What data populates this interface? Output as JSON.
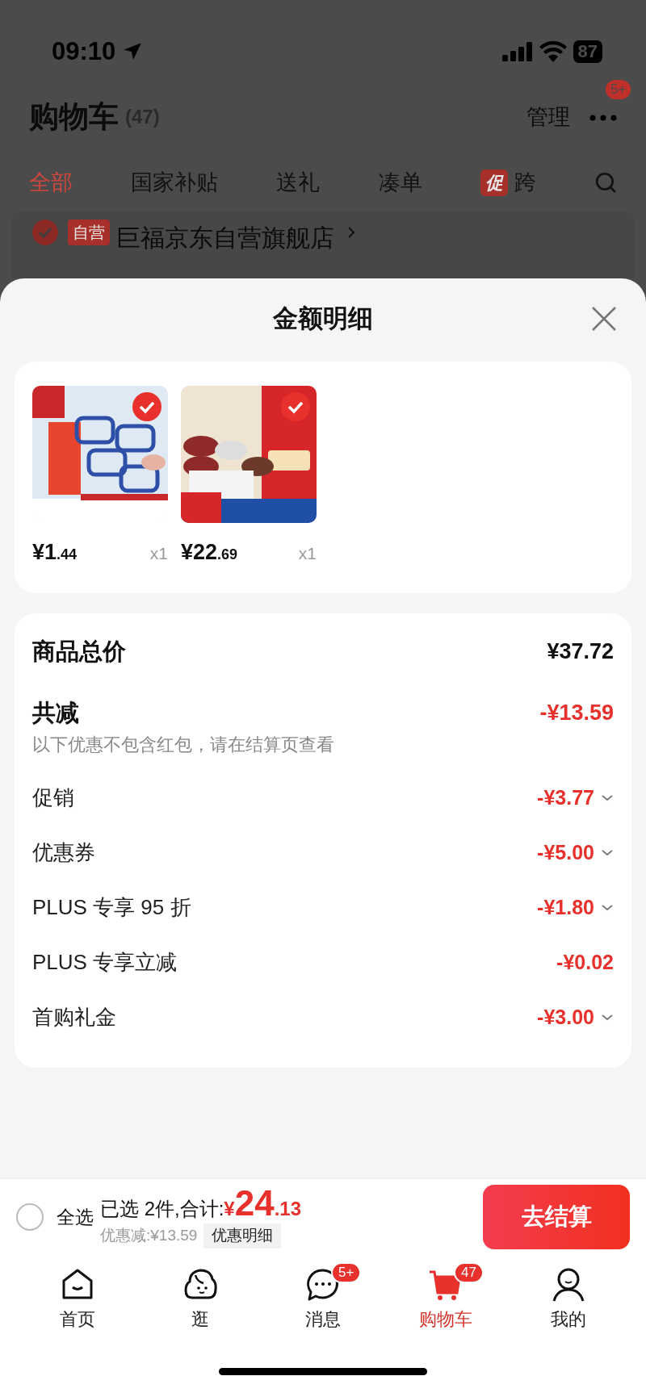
{
  "status_bar": {
    "time": "09:10",
    "battery": "87"
  },
  "header": {
    "title": "购物车",
    "count": "(47)",
    "manage": "管理",
    "more_badge": "5+"
  },
  "tabs": [
    {
      "label": "全部",
      "selected": true
    },
    {
      "label": "国家补贴",
      "selected": false
    },
    {
      "label": "送礼",
      "selected": false
    },
    {
      "label": "凑单",
      "selected": false
    },
    {
      "label": "跨",
      "tag": "促",
      "selected": false
    }
  ],
  "store": {
    "checked": true,
    "tag": "自营",
    "name": "巨福京东自营旗舰店"
  },
  "sheet": {
    "title": "金额明细",
    "items": [
      {
        "price": "¥1.44",
        "qty": "x1",
        "selected": true
      },
      {
        "price": "¥22.69",
        "qty": "x1",
        "selected": true
      }
    ],
    "total": {
      "label": "商品总价",
      "value": "¥37.72"
    },
    "reduction": {
      "label": "共减",
      "value": "-¥13.59",
      "note": "以下优惠不包含红包，请在结算页查看"
    },
    "discounts": [
      {
        "label": "促销",
        "value": "-¥3.77",
        "expandable": true
      },
      {
        "label": "优惠券",
        "value": "-¥5.00",
        "expandable": true
      },
      {
        "label": "PLUS 专享 95 折",
        "value": "-¥1.80",
        "expandable": true
      },
      {
        "label": "PLUS 专享立减",
        "value": "-¥0.02",
        "expandable": false
      },
      {
        "label": "首购礼金",
        "value": "-¥3.00",
        "expandable": true
      }
    ]
  },
  "checkout": {
    "select_all": {
      "label": "全选",
      "checked": false
    },
    "summary": "已选 2件,合计:",
    "total": "¥24.13",
    "discount": "优惠减:¥13.59",
    "detail": "优惠明细",
    "button": "去结算"
  },
  "nav": [
    {
      "kind": "home",
      "label": "首页",
      "selected": false
    },
    {
      "kind": "browse",
      "label": "逛",
      "selected": false
    },
    {
      "kind": "messages",
      "label": "消息",
      "badge": "5+",
      "selected": false
    },
    {
      "kind": "cart",
      "label": "购物车",
      "badge": "47",
      "selected": true
    },
    {
      "kind": "profile",
      "label": "我的",
      "selected": false
    }
  ]
}
